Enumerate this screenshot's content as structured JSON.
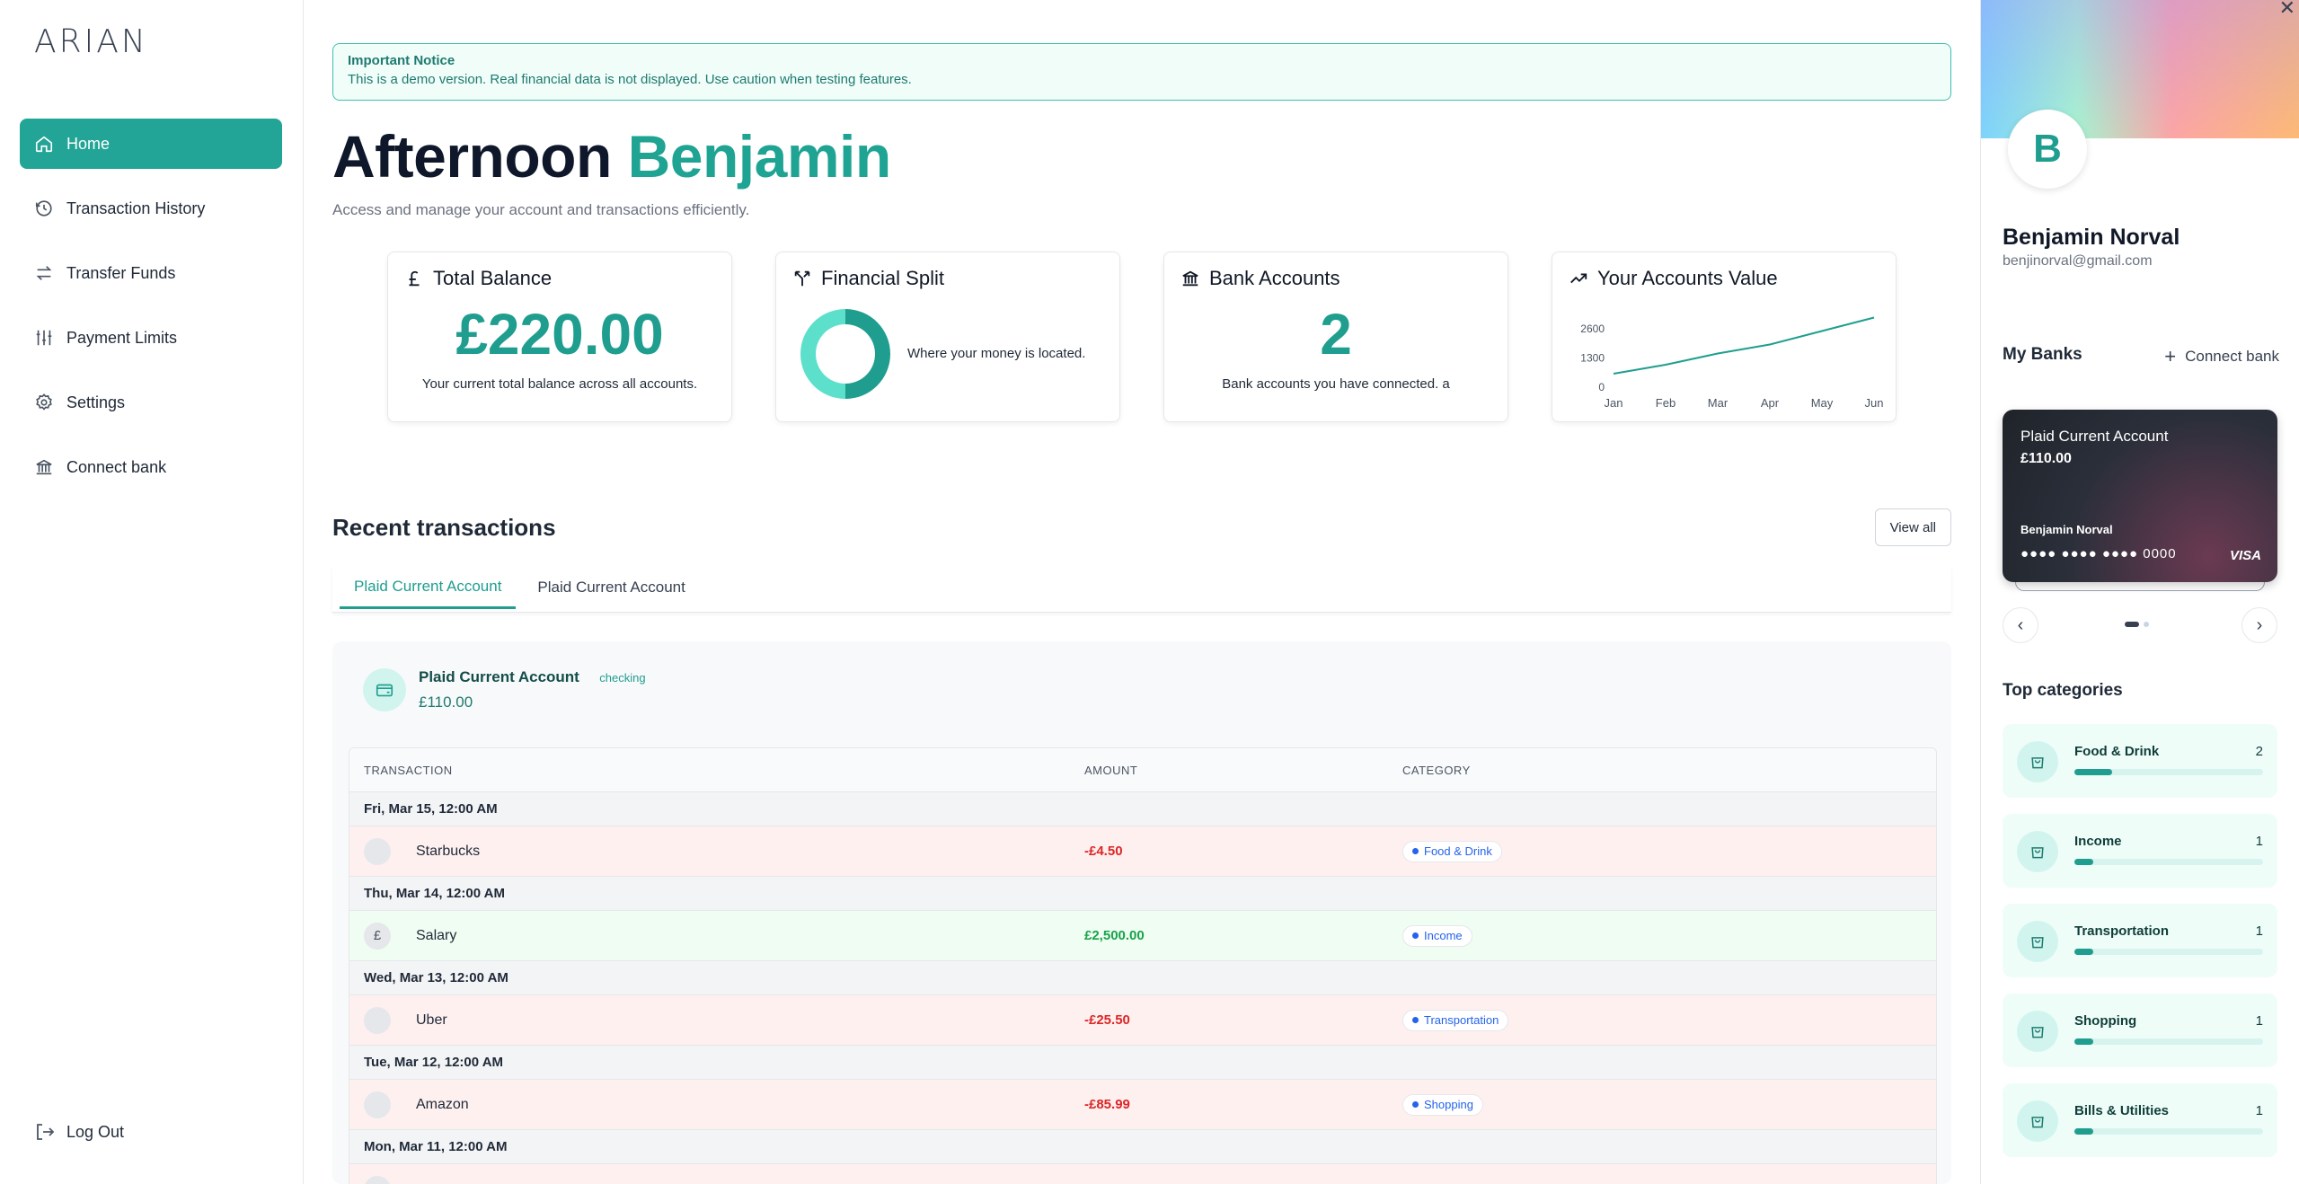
{
  "brand": {
    "logo": "ARIAN",
    "accent": "#22a596"
  },
  "sidebar": {
    "items": [
      {
        "label": "Home",
        "icon": "home-icon",
        "active": true
      },
      {
        "label": "Transaction History",
        "icon": "history-icon"
      },
      {
        "label": "Transfer Funds",
        "icon": "transfer-icon"
      },
      {
        "label": "Payment Limits",
        "icon": "sliders-icon"
      },
      {
        "label": "Settings",
        "icon": "gear-icon"
      },
      {
        "label": "Connect bank",
        "icon": "bank-icon"
      }
    ],
    "logout": "Log Out"
  },
  "notice": {
    "title": "Important Notice",
    "text": "This is a demo version. Real financial data is not displayed. Use caution when testing features."
  },
  "header": {
    "greeting": "Afternoon",
    "name": "Benjamin",
    "subtitle": "Access and manage your account and transactions efficiently."
  },
  "cards": {
    "balance": {
      "title": "Total Balance",
      "value": "£220.00",
      "desc": "Your current total balance across all accounts."
    },
    "split": {
      "title": "Financial Split",
      "desc": "Where your money is located.",
      "shares": [
        50,
        50
      ],
      "colors": [
        "#1f9e8f",
        "#5ce0cc"
      ]
    },
    "accounts": {
      "title": "Bank Accounts",
      "value": "2",
      "desc": "Bank accounts you have connected. a"
    },
    "value": {
      "title": "Your Accounts Value"
    }
  },
  "chart_data": {
    "type": "line",
    "categories": [
      "Jan",
      "Feb",
      "Mar",
      "Apr",
      "May",
      "Jun"
    ],
    "values": [
      600,
      1000,
      1500,
      1900,
      2500,
      3100
    ],
    "yticks": [
      "2600",
      "1300",
      "0"
    ],
    "ylim": [
      0,
      3200
    ],
    "color": "#1f9e8f"
  },
  "transactions": {
    "title": "Recent transactions",
    "view_all": "View all",
    "tabs": [
      "Plaid Current Account",
      "Plaid Current Account"
    ],
    "account": {
      "name": "Plaid Current Account",
      "type": "checking",
      "balance": "£110.00"
    },
    "columns": [
      "TRANSACTION",
      "AMOUNT",
      "CATEGORY"
    ],
    "groups": [
      {
        "date": "Fri, Mar 15, 12:00 AM",
        "name": "Starbucks",
        "amount": "-£4.50",
        "category": "Food & Drink",
        "kind": "neg",
        "avatar": ""
      },
      {
        "date": "Thu, Mar 14, 12:00 AM",
        "name": "Salary",
        "amount": "£2,500.00",
        "category": "Income",
        "kind": "pos",
        "avatar": "£"
      },
      {
        "date": "Wed, Mar 13, 12:00 AM",
        "name": "Uber",
        "amount": "-£25.50",
        "category": "Transportation",
        "kind": "neg",
        "avatar": ""
      },
      {
        "date": "Tue, Mar 12, 12:00 AM",
        "name": "Amazon",
        "amount": "-£85.99",
        "category": "Shopping",
        "kind": "neg",
        "avatar": ""
      },
      {
        "date": "Mon, Mar 11, 12:00 AM",
        "name": "",
        "amount": "",
        "category": "",
        "kind": "neg",
        "avatar": ""
      }
    ]
  },
  "profile": {
    "initial": "B",
    "name": "Benjamin Norval",
    "email": "benjinorval@gmail.com",
    "my_banks": "My Banks",
    "connect_bank": "Connect bank",
    "card": {
      "title": "Plaid Current Account",
      "balance": "£110.00",
      "holder": "Benjamin Norval",
      "number": "●●●● ●●●● ●●●● 0000",
      "network": "VISA"
    },
    "top_categories_title": "Top categories",
    "categories": [
      {
        "name": "Food & Drink",
        "count": "2",
        "fill": 0.2
      },
      {
        "name": "Income",
        "count": "1",
        "fill": 0.1
      },
      {
        "name": "Transportation",
        "count": "1",
        "fill": 0.1
      },
      {
        "name": "Shopping",
        "count": "1",
        "fill": 0.1
      },
      {
        "name": "Bills & Utilities",
        "count": "1",
        "fill": 0.1
      }
    ]
  }
}
